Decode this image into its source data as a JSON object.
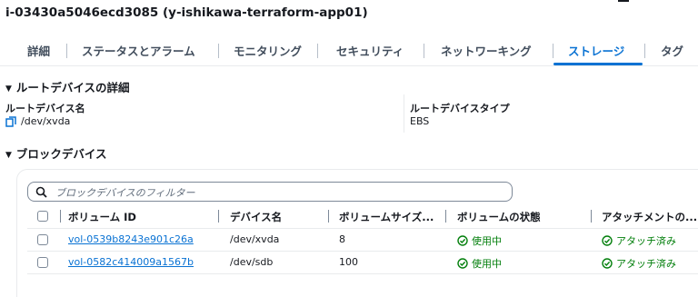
{
  "instance_title": "i-03430a5046ecd3085 (y-ishikawa-terraform-app01)",
  "tabs": [
    {
      "label": "詳細"
    },
    {
      "label": "ステータスとアラーム"
    },
    {
      "label": "モニタリング"
    },
    {
      "label": "セキュリティ"
    },
    {
      "label": "ネットワーキング"
    },
    {
      "label": "ストレージ",
      "active": true
    },
    {
      "label": "タグ"
    }
  ],
  "root_device": {
    "heading": "ルートデバイスの詳細",
    "name_label": "ルートデバイス名",
    "name_value": "/dev/xvda",
    "type_label": "ルートデバイスタイプ",
    "type_value": "EBS"
  },
  "block_devices": {
    "heading": "ブロックデバイス",
    "search_placeholder": "ブロックデバイスのフィルター",
    "columns": [
      "ボリューム ID",
      "デバイス名",
      "ボリュームサイズ...",
      "ボリュームの状態",
      "アタッチメントの..."
    ],
    "rows": [
      {
        "volume_id": "vol-0539b8243e901c26a",
        "device": "/dev/xvda",
        "size": "8",
        "state": "使用中",
        "attachment": "アタッチ済み"
      },
      {
        "volume_id": "vol-0582c414009a1567b",
        "device": "/dev/sdb",
        "size": "100",
        "state": "使用中",
        "attachment": "アタッチ済み"
      }
    ]
  },
  "colors": {
    "link": "#0972d3",
    "success": "#037f0c",
    "text": "#16191f"
  }
}
